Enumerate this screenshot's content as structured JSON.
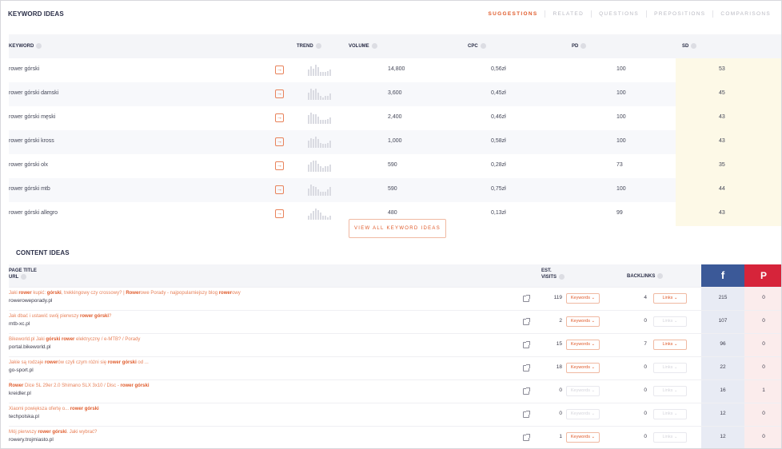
{
  "keyword_ideas": {
    "title": "KEYWORD IDEAS",
    "tabs": [
      {
        "label": "SUGGESTIONS",
        "active": true
      },
      {
        "label": "RELATED",
        "active": false
      },
      {
        "label": "QUESTIONS",
        "active": false
      },
      {
        "label": "PREPOSITIONS",
        "active": false
      },
      {
        "label": "COMPARISONS",
        "active": false
      }
    ],
    "columns": {
      "keyword": "KEYWORD",
      "trend": "TREND",
      "volume": "VOLUME",
      "cpc": "CPC",
      "pd": "PD",
      "sd": "SD"
    },
    "rows": [
      {
        "keyword": "rower górski",
        "volume": "14,800",
        "cpc": "0,56zł",
        "pd": "100",
        "sd": "53",
        "trend": [
          5,
          8,
          6,
          9,
          7,
          3,
          3,
          3,
          4,
          5
        ]
      },
      {
        "keyword": "rower górski damski",
        "volume": "3,600",
        "cpc": "0,45zł",
        "pd": "100",
        "sd": "45",
        "trend": [
          6,
          9,
          8,
          9,
          6,
          3,
          2,
          3,
          3,
          5
        ]
      },
      {
        "keyword": "rower górski męski",
        "volume": "2,400",
        "cpc": "0,46zł",
        "pd": "100",
        "sd": "43",
        "trend": [
          7,
          9,
          8,
          8,
          6,
          3,
          3,
          3,
          4,
          5
        ]
      },
      {
        "keyword": "rower górski kross",
        "volume": "1,000",
        "cpc": "0,58zł",
        "pd": "100",
        "sd": "43",
        "trend": [
          6,
          8,
          7,
          9,
          7,
          4,
          3,
          3,
          4,
          6
        ]
      },
      {
        "keyword": "rower górski olx",
        "volume": "590",
        "cpc": "0,28zł",
        "pd": "73",
        "sd": "35",
        "trend": [
          5,
          7,
          8,
          8,
          6,
          4,
          3,
          4,
          4,
          5
        ]
      },
      {
        "keyword": "rower górski mtb",
        "volume": "590",
        "cpc": "0,75zł",
        "pd": "100",
        "sd": "44",
        "trend": [
          6,
          9,
          8,
          7,
          5,
          3,
          3,
          3,
          5,
          7
        ]
      },
      {
        "keyword": "rower górski allegro",
        "volume": "480",
        "cpc": "0,13zł",
        "pd": "99",
        "sd": "43",
        "trend": [
          3,
          5,
          7,
          9,
          8,
          6,
          3,
          3,
          2,
          3
        ]
      }
    ],
    "view_all_label": "VIEW ALL KEYWORD IDEAS"
  },
  "content_ideas": {
    "title": "CONTENT IDEAS",
    "columns": {
      "page_title": "PAGE TITLE",
      "url": "URL",
      "est": "EST.",
      "visits": "VISITS",
      "backlinks": "BACKLINKS",
      "facebook": "f",
      "pinterest": "P"
    },
    "keywords_label": "Keywords ⌄",
    "links_label": "Links ⌄",
    "rows": [
      {
        "title_parts": [
          [
            "Jaki ",
            false
          ],
          [
            "rower",
            true
          ],
          [
            " kupić: ",
            false
          ],
          [
            "górski",
            true
          ],
          [
            ", trekkingowy czy crossowy? | ",
            false
          ],
          [
            "Rower",
            true
          ],
          [
            "owe Porady - najpopularniejszy blog ",
            false
          ],
          [
            "rower",
            true
          ],
          [
            "owy",
            false
          ]
        ],
        "url": "roweroweporady.pl",
        "visits": "119",
        "keywords_enabled": true,
        "backlinks": "4",
        "links_enabled": true,
        "facebook": "215",
        "pinterest": "0"
      },
      {
        "title_parts": [
          [
            "Jak dbać i ustawić swój pierwszy ",
            false
          ],
          [
            "rower górski",
            true
          ],
          [
            "?",
            false
          ]
        ],
        "url": "mtb-xc.pl",
        "visits": "2",
        "keywords_enabled": true,
        "backlinks": "0",
        "links_enabled": false,
        "facebook": "107",
        "pinterest": "0"
      },
      {
        "title_parts": [
          [
            "Bikeworld.pl Jaki ",
            false
          ],
          [
            "górski rower",
            true
          ],
          [
            " elektryczny / e-MTB? / Porady",
            false
          ]
        ],
        "url": "portal.bikeworld.pl",
        "visits": "15",
        "keywords_enabled": true,
        "backlinks": "7",
        "links_enabled": true,
        "facebook": "96",
        "pinterest": "0"
      },
      {
        "title_parts": [
          [
            "Jakie są rodzaje ",
            false
          ],
          [
            "rower",
            true
          ],
          [
            "ów czyli czym różni się ",
            false
          ],
          [
            "rower górski",
            true
          ],
          [
            " od ...",
            false
          ]
        ],
        "url": "go-sport.pl",
        "visits": "18",
        "keywords_enabled": true,
        "backlinks": "0",
        "links_enabled": false,
        "facebook": "22",
        "pinterest": "0"
      },
      {
        "title_parts": [
          [
            "Rower",
            true
          ],
          [
            " Dice SL 29er 2.0 Shimano SLX 3x10 / Disc - ",
            false
          ],
          [
            "rower górski",
            true
          ]
        ],
        "url": "kreidler.pl",
        "visits": "0",
        "keywords_enabled": false,
        "backlinks": "0",
        "links_enabled": false,
        "facebook": "16",
        "pinterest": "1"
      },
      {
        "title_parts": [
          [
            "Xiaomi powiększa ofertę o... ",
            false
          ],
          [
            "rower górski",
            true
          ]
        ],
        "url": "techpolska.pl",
        "visits": "0",
        "keywords_enabled": false,
        "backlinks": "0",
        "links_enabled": false,
        "facebook": "12",
        "pinterest": "0"
      },
      {
        "title_parts": [
          [
            "Mój pierwszy ",
            false
          ],
          [
            "rower górski",
            true
          ],
          [
            ". Jaki wybrać?",
            false
          ]
        ],
        "url": "rowery.trojmiasto.pl",
        "visits": "1",
        "keywords_enabled": true,
        "backlinks": "0",
        "links_enabled": false,
        "facebook": "12",
        "pinterest": "0"
      }
    ]
  }
}
